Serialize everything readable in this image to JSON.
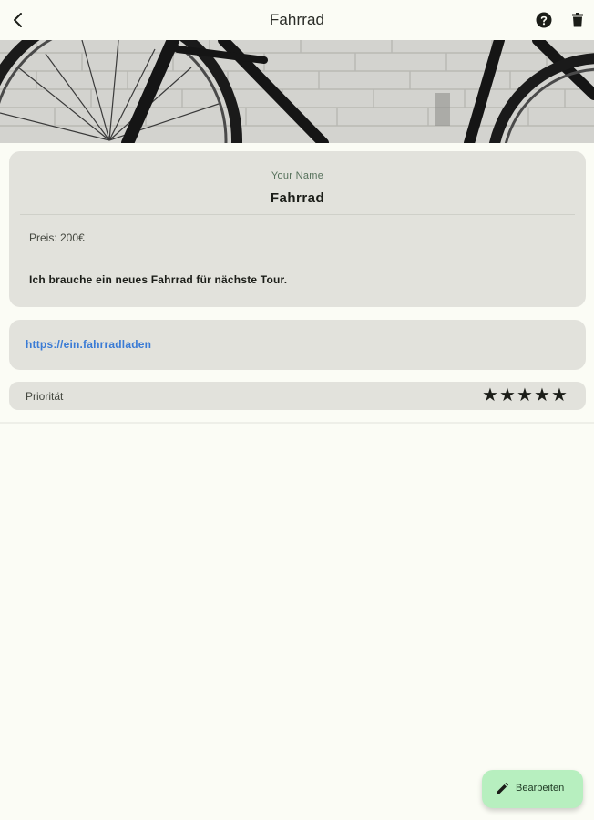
{
  "app_bar": {
    "title": "Fahrrad",
    "back_icon": "chevron-left-icon",
    "help_icon": "help-circle-icon",
    "delete_icon": "trash-icon"
  },
  "hero": {
    "image": "bicycle-against-brick-wall"
  },
  "item": {
    "owner": "Your Name",
    "title": "Fahrrad",
    "price": "Preis: 200€",
    "description": "Ich brauche ein neues Fahrrad für nächste Tour."
  },
  "link": {
    "url": "https://ein.fahrradladen"
  },
  "priority": {
    "label": "Priorität",
    "stars": 5,
    "max_stars": 5
  },
  "fab": {
    "label": "Bearbeiten",
    "icon": "pencil-icon",
    "color": "#b7efbf"
  },
  "colors": {
    "background": "#fbfcf5",
    "card": "#e2e2dc",
    "link": "#3a7bd5",
    "owner": "#55705a"
  }
}
